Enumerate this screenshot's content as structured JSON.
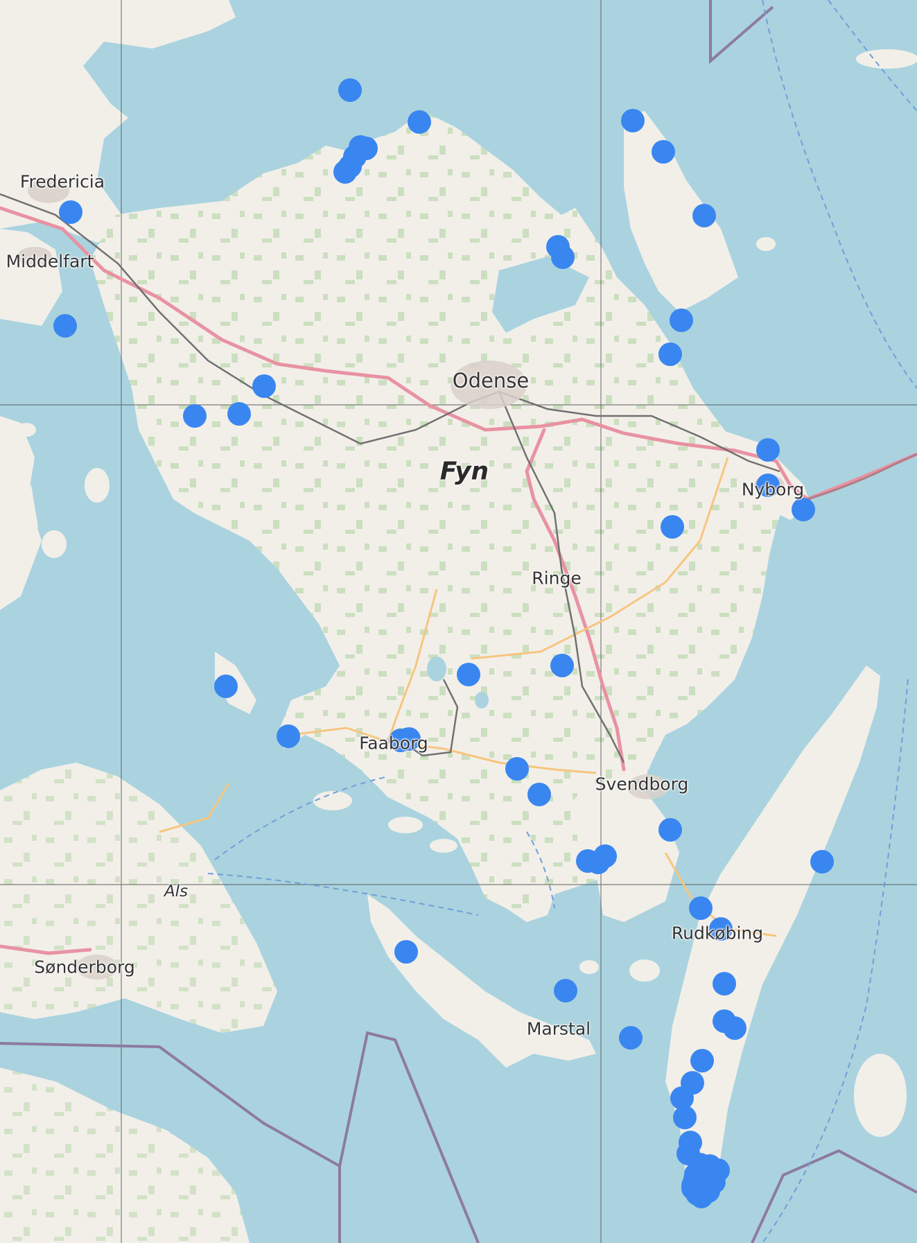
{
  "map": {
    "labels": {
      "fredericia": "Fredericia",
      "middelfart": "Middelfart",
      "odense": "Odense",
      "fyn": "Fyn",
      "ringe": "Ringe",
      "nyborg": "Nyborg",
      "faaborg": "Faaborg",
      "svendborg": "Svendborg",
      "als": "Als",
      "sonderborg": "Sønderborg",
      "rudkobing": "Rudkøbing",
      "marstal": "Marstal"
    },
    "colors": {
      "water": "#aad3df",
      "land": "#f2efe9",
      "forest": "#add19e",
      "highway": "#e892a2",
      "secondary_road": "#f7c57f",
      "railway": "#707070",
      "border": "#8e7aa0",
      "marker": "#3a86f0"
    },
    "marker_count": 66
  }
}
